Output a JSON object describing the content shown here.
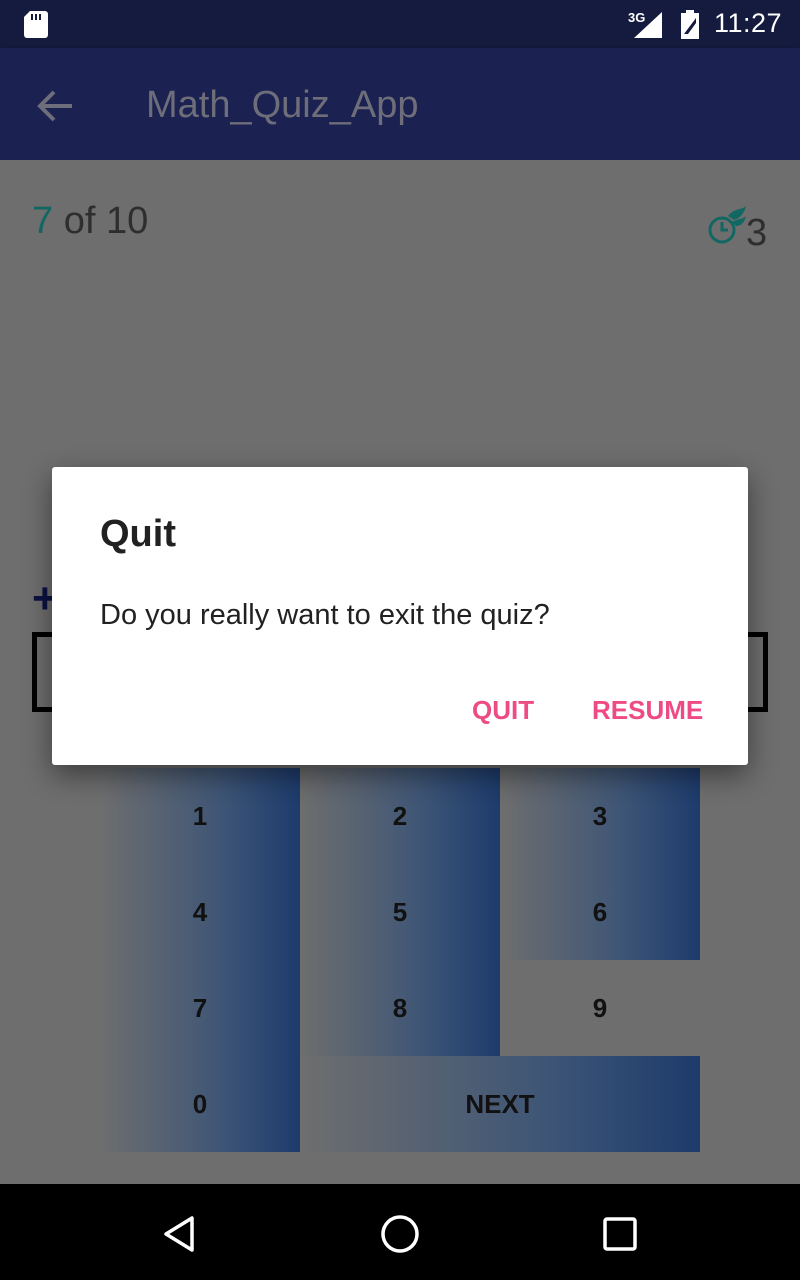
{
  "status_bar": {
    "network": "3G",
    "time": "11:27"
  },
  "app_bar": {
    "title": "Math_Quiz_App"
  },
  "quiz": {
    "current_question": "7",
    "of_text": " of 10",
    "timer_value": "3",
    "question_text": "+"
  },
  "keypad": {
    "keys": [
      "1",
      "2",
      "3",
      "4",
      "5",
      "6",
      "7",
      "8",
      "9",
      "0"
    ],
    "next_label": "NEXT"
  },
  "dialog": {
    "title": "Quit",
    "message": "Do you really want to exit the quiz?",
    "quit_label": "QUIT",
    "resume_label": "RESUME"
  },
  "colors": {
    "status_bar": "#151a3f",
    "app_bar": "#1b2150",
    "accent": "#ee4b85",
    "progress_current": "#126763",
    "keypad_gradient_end": "#1d3b6c"
  },
  "icons": [
    "sd-card-icon",
    "signal-icon",
    "battery-icon",
    "back-arrow-icon",
    "timer-icon",
    "back-triangle-icon",
    "home-circle-icon",
    "recents-square-icon"
  ]
}
